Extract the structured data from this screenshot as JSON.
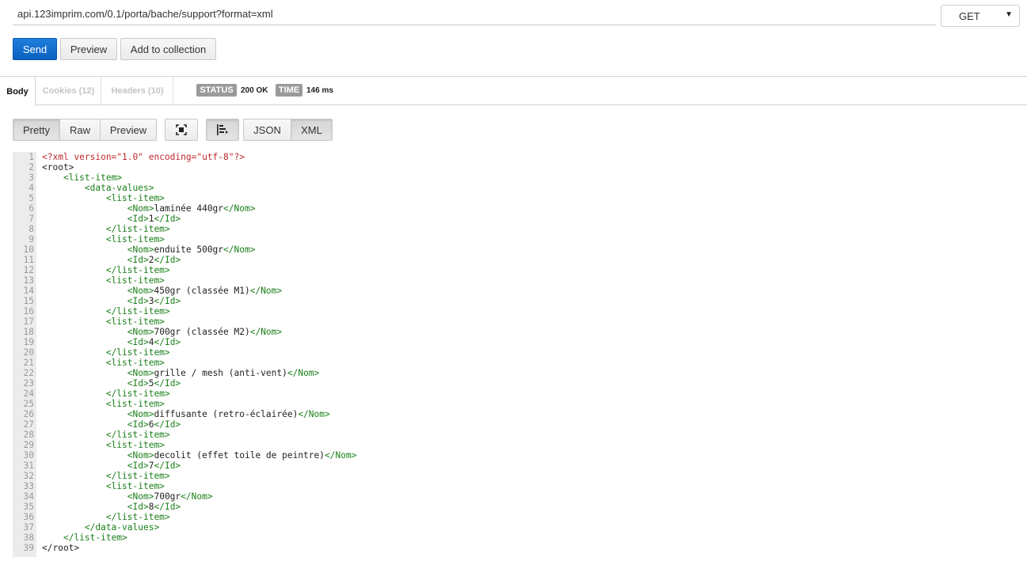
{
  "request": {
    "url": "api.123imprim.com/0.1/porta/bache/support?format=xml",
    "method": "GET",
    "send_label": "Send",
    "preview_label": "Preview",
    "add_to_collection_label": "Add to collection"
  },
  "response": {
    "tabs": {
      "body": "Body",
      "cookies": "Cookies (12)",
      "headers": "Headers (10)"
    },
    "status_label": "STATUS",
    "status_value": "200 OK",
    "time_label": "TIME",
    "time_value": "146 ms"
  },
  "view": {
    "pretty": "Pretty",
    "raw": "Raw",
    "preview": "Preview",
    "json": "JSON",
    "xml": "XML",
    "expand_icon": "expand-icon",
    "wrap_icon": "wrap-lines-icon"
  },
  "colors": {
    "tag": "#1a7f1a",
    "declaration": "#c0272d",
    "text": "#222222",
    "accent": "#0a5fbf"
  },
  "code_lines": [
    [
      [
        "decl",
        "<?xml version=\"1.0\" encoding=\"utf-8\"?>"
      ]
    ],
    [
      [
        "txt",
        "<root>"
      ]
    ],
    [
      [
        "txt",
        "    "
      ],
      [
        "tag",
        "<list-item>"
      ]
    ],
    [
      [
        "txt",
        "        "
      ],
      [
        "tag",
        "<data-values>"
      ]
    ],
    [
      [
        "txt",
        "            "
      ],
      [
        "tag",
        "<list-item>"
      ]
    ],
    [
      [
        "txt",
        "                "
      ],
      [
        "tag",
        "<Nom>"
      ],
      [
        "txt",
        "laminée 440gr"
      ],
      [
        "tag",
        "</Nom>"
      ]
    ],
    [
      [
        "txt",
        "                "
      ],
      [
        "tag",
        "<Id>"
      ],
      [
        "txt",
        "1"
      ],
      [
        "tag",
        "</Id>"
      ]
    ],
    [
      [
        "txt",
        "            "
      ],
      [
        "tag",
        "</list-item>"
      ]
    ],
    [
      [
        "txt",
        "            "
      ],
      [
        "tag",
        "<list-item>"
      ]
    ],
    [
      [
        "txt",
        "                "
      ],
      [
        "tag",
        "<Nom>"
      ],
      [
        "txt",
        "enduite 500gr"
      ],
      [
        "tag",
        "</Nom>"
      ]
    ],
    [
      [
        "txt",
        "                "
      ],
      [
        "tag",
        "<Id>"
      ],
      [
        "txt",
        "2"
      ],
      [
        "tag",
        "</Id>"
      ]
    ],
    [
      [
        "txt",
        "            "
      ],
      [
        "tag",
        "</list-item>"
      ]
    ],
    [
      [
        "txt",
        "            "
      ],
      [
        "tag",
        "<list-item>"
      ]
    ],
    [
      [
        "txt",
        "                "
      ],
      [
        "tag",
        "<Nom>"
      ],
      [
        "txt",
        "450gr (classée M1)"
      ],
      [
        "tag",
        "</Nom>"
      ]
    ],
    [
      [
        "txt",
        "                "
      ],
      [
        "tag",
        "<Id>"
      ],
      [
        "txt",
        "3"
      ],
      [
        "tag",
        "</Id>"
      ]
    ],
    [
      [
        "txt",
        "            "
      ],
      [
        "tag",
        "</list-item>"
      ]
    ],
    [
      [
        "txt",
        "            "
      ],
      [
        "tag",
        "<list-item>"
      ]
    ],
    [
      [
        "txt",
        "                "
      ],
      [
        "tag",
        "<Nom>"
      ],
      [
        "txt",
        "700gr (classée M2)"
      ],
      [
        "tag",
        "</Nom>"
      ]
    ],
    [
      [
        "txt",
        "                "
      ],
      [
        "tag",
        "<Id>"
      ],
      [
        "txt",
        "4"
      ],
      [
        "tag",
        "</Id>"
      ]
    ],
    [
      [
        "txt",
        "            "
      ],
      [
        "tag",
        "</list-item>"
      ]
    ],
    [
      [
        "txt",
        "            "
      ],
      [
        "tag",
        "<list-item>"
      ]
    ],
    [
      [
        "txt",
        "                "
      ],
      [
        "tag",
        "<Nom>"
      ],
      [
        "txt",
        "grille / mesh (anti-vent)"
      ],
      [
        "tag",
        "</Nom>"
      ]
    ],
    [
      [
        "txt",
        "                "
      ],
      [
        "tag",
        "<Id>"
      ],
      [
        "txt",
        "5"
      ],
      [
        "tag",
        "</Id>"
      ]
    ],
    [
      [
        "txt",
        "            "
      ],
      [
        "tag",
        "</list-item>"
      ]
    ],
    [
      [
        "txt",
        "            "
      ],
      [
        "tag",
        "<list-item>"
      ]
    ],
    [
      [
        "txt",
        "                "
      ],
      [
        "tag",
        "<Nom>"
      ],
      [
        "txt",
        "diffusante (retro-éclairée)"
      ],
      [
        "tag",
        "</Nom>"
      ]
    ],
    [
      [
        "txt",
        "                "
      ],
      [
        "tag",
        "<Id>"
      ],
      [
        "txt",
        "6"
      ],
      [
        "tag",
        "</Id>"
      ]
    ],
    [
      [
        "txt",
        "            "
      ],
      [
        "tag",
        "</list-item>"
      ]
    ],
    [
      [
        "txt",
        "            "
      ],
      [
        "tag",
        "<list-item>"
      ]
    ],
    [
      [
        "txt",
        "                "
      ],
      [
        "tag",
        "<Nom>"
      ],
      [
        "txt",
        "decolit (effet toile de peintre)"
      ],
      [
        "tag",
        "</Nom>"
      ]
    ],
    [
      [
        "txt",
        "                "
      ],
      [
        "tag",
        "<Id>"
      ],
      [
        "txt",
        "7"
      ],
      [
        "tag",
        "</Id>"
      ]
    ],
    [
      [
        "txt",
        "            "
      ],
      [
        "tag",
        "</list-item>"
      ]
    ],
    [
      [
        "txt",
        "            "
      ],
      [
        "tag",
        "<list-item>"
      ]
    ],
    [
      [
        "txt",
        "                "
      ],
      [
        "tag",
        "<Nom>"
      ],
      [
        "txt",
        "700gr"
      ],
      [
        "tag",
        "</Nom>"
      ]
    ],
    [
      [
        "txt",
        "                "
      ],
      [
        "tag",
        "<Id>"
      ],
      [
        "txt",
        "8"
      ],
      [
        "tag",
        "</Id>"
      ]
    ],
    [
      [
        "txt",
        "            "
      ],
      [
        "tag",
        "</list-item>"
      ]
    ],
    [
      [
        "txt",
        "        "
      ],
      [
        "tag",
        "</data-values>"
      ]
    ],
    [
      [
        "txt",
        "    "
      ],
      [
        "tag",
        "</list-item>"
      ]
    ],
    [
      [
        "txt",
        "</root>"
      ]
    ]
  ]
}
